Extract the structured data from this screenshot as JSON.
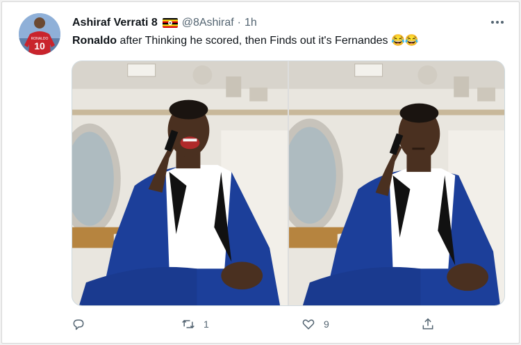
{
  "tweet": {
    "author_name": "Ashiraf Verrati 8",
    "handle": "@8Ashiraf",
    "separator": "·",
    "time": "1h",
    "text_bold": "Ronaldo",
    "text_rest": " after Thinking he scored, then Finds out it's Fernandes 😂😂",
    "avatar_jersey_name": "RONALDO",
    "avatar_jersey_number": "10",
    "flag_icon": "uganda-flag-icon",
    "photos": [
      {
        "id": "photo-left",
        "expression": "laughing"
      },
      {
        "id": "photo-right",
        "expression": "serious"
      }
    ]
  },
  "actions": {
    "reply_count": "",
    "retweet_count": "1",
    "like_count": "9",
    "share_count": ""
  },
  "colors": {
    "secondary_text": "#536471",
    "suit_blue": "#1c3f9a",
    "background": "#ffffff"
  }
}
